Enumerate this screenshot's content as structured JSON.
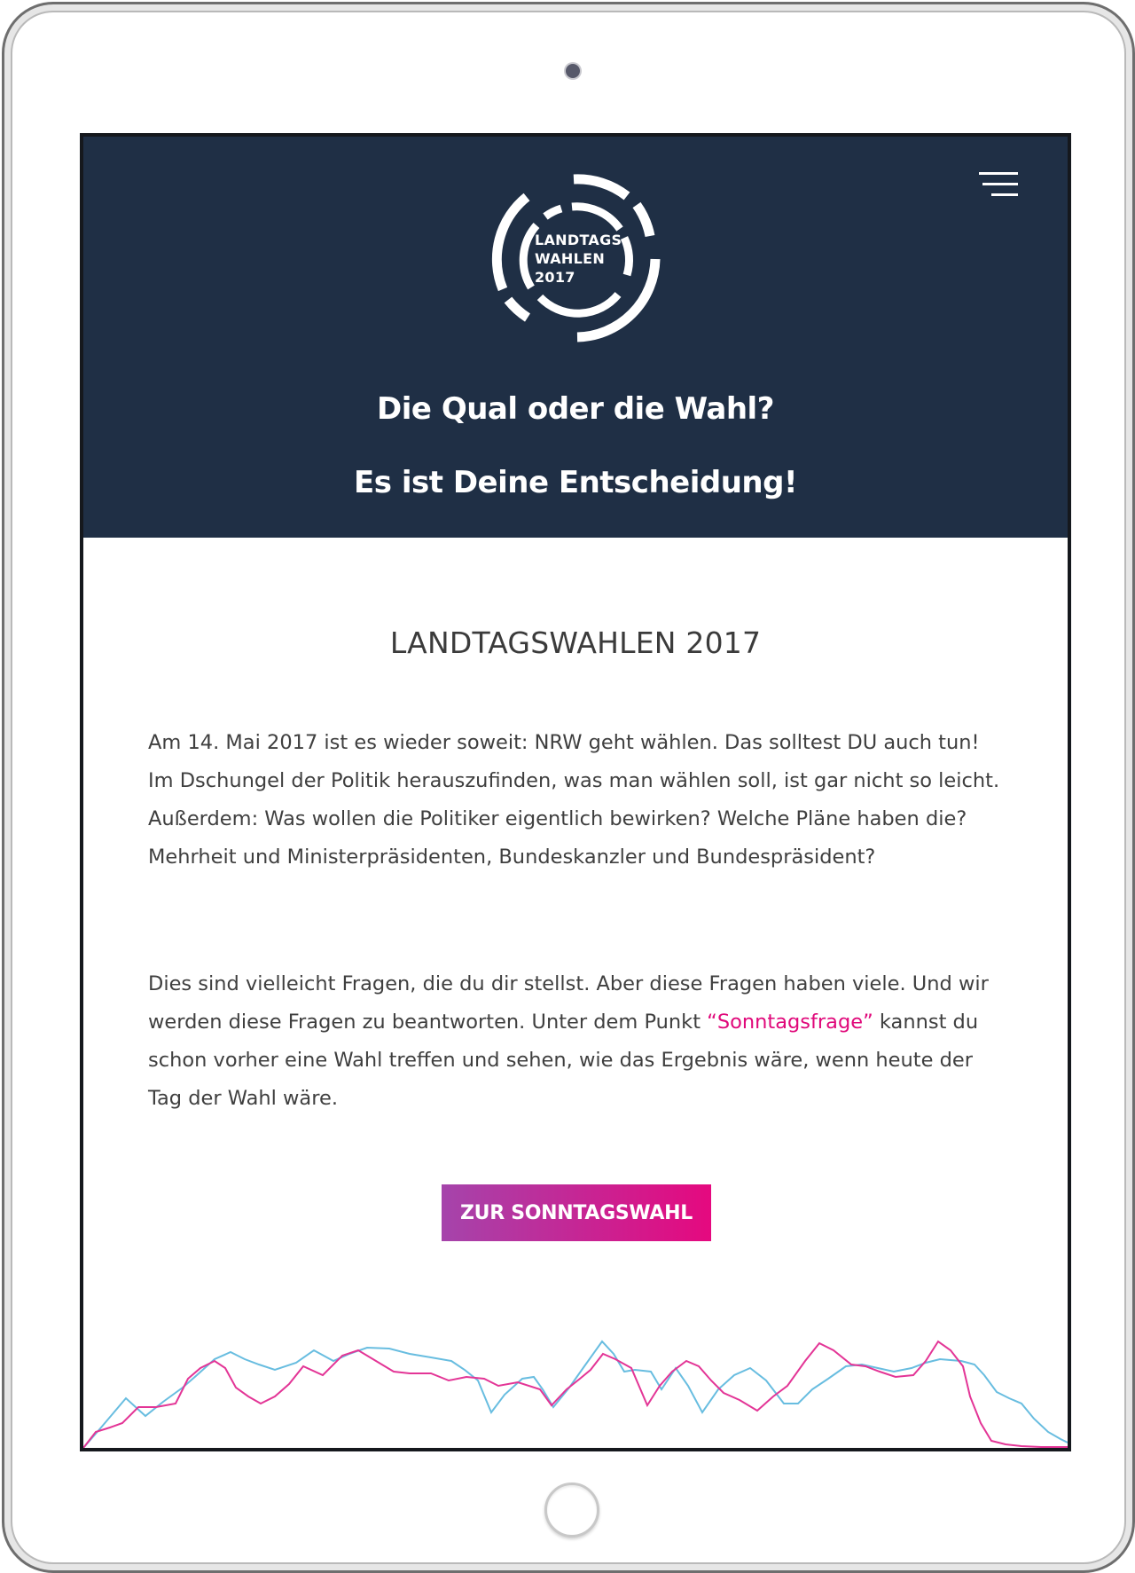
{
  "hero": {
    "logo_lines": [
      "LANDTAGS",
      "WAHLEN",
      "2017"
    ],
    "headline_1": "Die Qual oder die Wahl?",
    "headline_2": "Es ist Deine Entscheidung!"
  },
  "content": {
    "title": "LANDTAGSWAHLEN 2017",
    "paragraph_1": "Am 14. Mai 2017 ist es wieder soweit: NRW geht wählen. Das solltest DU auch tun! Im Dschungel der Politik herauszufinden, was man wählen soll, ist gar nicht so leicht. Außerdem: Was wollen die Politiker eigentlich bewirken? Welche Pläne haben die? Mehrheit und Ministerpräsidenten, Bundeskanzler und Bundespräsident?",
    "paragraph_2_before": "Dies sind vielleicht Fragen, die du dir stellst. Aber diese Fragen haben viele. Und wir werden diese Fragen zu beantworten. Unter dem Punkt ",
    "paragraph_2_link": "“Sonntagsfrage”",
    "paragraph_2_after": " kannst du schon vorher eine Wahl treffen und sehen, wie das Ergebnis wäre, wenn heute der Tag der Wahl wäre.",
    "cta_label": "ZUR SONNTAGSWAHL"
  },
  "icons": {
    "menu": "hamburger-menu-icon",
    "logo": "ring-logo-icon"
  },
  "colors": {
    "hero_background": "#1f2f45",
    "accent_magenta": "#e0087a",
    "accent_purple": "#a544ab",
    "line_blue": "#68bde0",
    "line_pink": "#e33596",
    "text": "#3f3f3f"
  }
}
